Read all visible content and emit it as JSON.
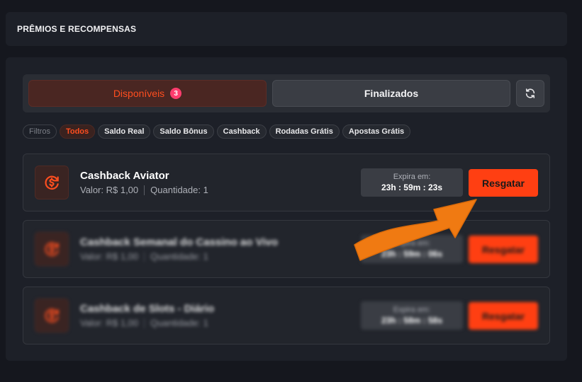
{
  "header": {
    "title": "PRÊMIOS E RECOMPENSAS"
  },
  "tabs": {
    "active": {
      "label": "Disponíveis",
      "badge": "3"
    },
    "inactive": {
      "label": "Finalizados"
    },
    "refresh_icon": "refresh-icon"
  },
  "filters": {
    "label": "Filtros",
    "chips": [
      "Todos",
      "Saldo Real",
      "Saldo Bônus",
      "Cashback",
      "Rodadas Grátis",
      "Apostas Grátis"
    ],
    "active_index": 0
  },
  "cards": [
    {
      "title": "Cashback Aviator",
      "value": "Valor: R$ 1,00",
      "quantity": "Quantidade: 1",
      "expire_label": "Expira em:",
      "expire_time": "23h : 59m : 23s",
      "button": "Resgatar",
      "icon": "cashback-icon",
      "blurred": false
    },
    {
      "title": "Cashback Semanal do Cassino ao Vivo",
      "value": "Valor: R$ 1,00",
      "quantity": "Quantidade: 1",
      "expire_label": "Expira em:",
      "expire_time": "23h : 59m : 06s",
      "button": "Resgatar",
      "icon": "cashback-icon",
      "blurred": true
    },
    {
      "title": "Cashback de Slots - Diário",
      "value": "Valor: R$ 1,00",
      "quantity": "Quantidade: 1",
      "expire_label": "Expira em:",
      "expire_time": "23h : 58m : 58s",
      "button": "Resgatar",
      "icon": "cashback-icon",
      "blurred": true
    }
  ],
  "colors": {
    "accent": "#ff3f12",
    "badge": "#ff3d6e",
    "arrow": "#f07a12"
  }
}
